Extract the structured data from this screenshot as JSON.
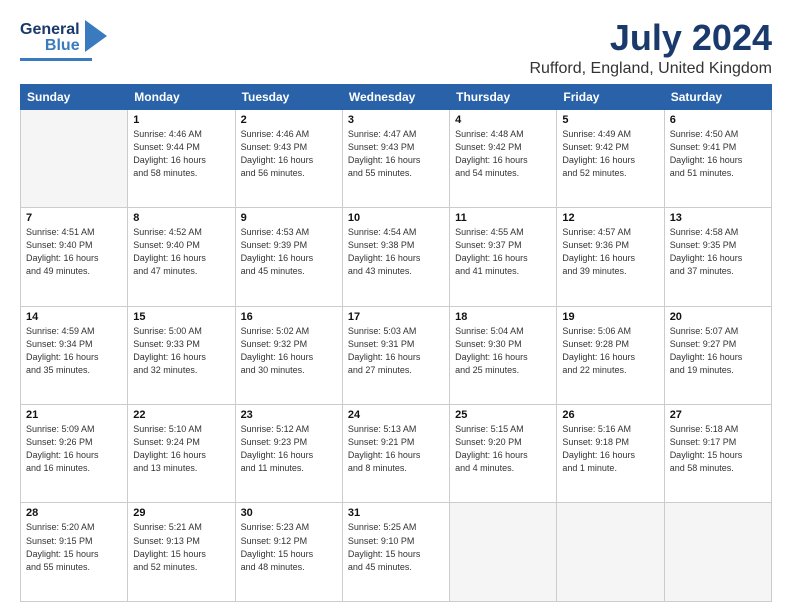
{
  "logo": {
    "line1": "General",
    "line2": "Blue"
  },
  "title": "July 2024",
  "subtitle": "Rufford, England, United Kingdom",
  "weekdays": [
    "Sunday",
    "Monday",
    "Tuesday",
    "Wednesday",
    "Thursday",
    "Friday",
    "Saturday"
  ],
  "weeks": [
    [
      {
        "day": "",
        "info": ""
      },
      {
        "day": "1",
        "info": "Sunrise: 4:46 AM\nSunset: 9:44 PM\nDaylight: 16 hours\nand 58 minutes."
      },
      {
        "day": "2",
        "info": "Sunrise: 4:46 AM\nSunset: 9:43 PM\nDaylight: 16 hours\nand 56 minutes."
      },
      {
        "day": "3",
        "info": "Sunrise: 4:47 AM\nSunset: 9:43 PM\nDaylight: 16 hours\nand 55 minutes."
      },
      {
        "day": "4",
        "info": "Sunrise: 4:48 AM\nSunset: 9:42 PM\nDaylight: 16 hours\nand 54 minutes."
      },
      {
        "day": "5",
        "info": "Sunrise: 4:49 AM\nSunset: 9:42 PM\nDaylight: 16 hours\nand 52 minutes."
      },
      {
        "day": "6",
        "info": "Sunrise: 4:50 AM\nSunset: 9:41 PM\nDaylight: 16 hours\nand 51 minutes."
      }
    ],
    [
      {
        "day": "7",
        "info": "Sunrise: 4:51 AM\nSunset: 9:40 PM\nDaylight: 16 hours\nand 49 minutes."
      },
      {
        "day": "8",
        "info": "Sunrise: 4:52 AM\nSunset: 9:40 PM\nDaylight: 16 hours\nand 47 minutes."
      },
      {
        "day": "9",
        "info": "Sunrise: 4:53 AM\nSunset: 9:39 PM\nDaylight: 16 hours\nand 45 minutes."
      },
      {
        "day": "10",
        "info": "Sunrise: 4:54 AM\nSunset: 9:38 PM\nDaylight: 16 hours\nand 43 minutes."
      },
      {
        "day": "11",
        "info": "Sunrise: 4:55 AM\nSunset: 9:37 PM\nDaylight: 16 hours\nand 41 minutes."
      },
      {
        "day": "12",
        "info": "Sunrise: 4:57 AM\nSunset: 9:36 PM\nDaylight: 16 hours\nand 39 minutes."
      },
      {
        "day": "13",
        "info": "Sunrise: 4:58 AM\nSunset: 9:35 PM\nDaylight: 16 hours\nand 37 minutes."
      }
    ],
    [
      {
        "day": "14",
        "info": "Sunrise: 4:59 AM\nSunset: 9:34 PM\nDaylight: 16 hours\nand 35 minutes."
      },
      {
        "day": "15",
        "info": "Sunrise: 5:00 AM\nSunset: 9:33 PM\nDaylight: 16 hours\nand 32 minutes."
      },
      {
        "day": "16",
        "info": "Sunrise: 5:02 AM\nSunset: 9:32 PM\nDaylight: 16 hours\nand 30 minutes."
      },
      {
        "day": "17",
        "info": "Sunrise: 5:03 AM\nSunset: 9:31 PM\nDaylight: 16 hours\nand 27 minutes."
      },
      {
        "day": "18",
        "info": "Sunrise: 5:04 AM\nSunset: 9:30 PM\nDaylight: 16 hours\nand 25 minutes."
      },
      {
        "day": "19",
        "info": "Sunrise: 5:06 AM\nSunset: 9:28 PM\nDaylight: 16 hours\nand 22 minutes."
      },
      {
        "day": "20",
        "info": "Sunrise: 5:07 AM\nSunset: 9:27 PM\nDaylight: 16 hours\nand 19 minutes."
      }
    ],
    [
      {
        "day": "21",
        "info": "Sunrise: 5:09 AM\nSunset: 9:26 PM\nDaylight: 16 hours\nand 16 minutes."
      },
      {
        "day": "22",
        "info": "Sunrise: 5:10 AM\nSunset: 9:24 PM\nDaylight: 16 hours\nand 13 minutes."
      },
      {
        "day": "23",
        "info": "Sunrise: 5:12 AM\nSunset: 9:23 PM\nDaylight: 16 hours\nand 11 minutes."
      },
      {
        "day": "24",
        "info": "Sunrise: 5:13 AM\nSunset: 9:21 PM\nDaylight: 16 hours\nand 8 minutes."
      },
      {
        "day": "25",
        "info": "Sunrise: 5:15 AM\nSunset: 9:20 PM\nDaylight: 16 hours\nand 4 minutes."
      },
      {
        "day": "26",
        "info": "Sunrise: 5:16 AM\nSunset: 9:18 PM\nDaylight: 16 hours\nand 1 minute."
      },
      {
        "day": "27",
        "info": "Sunrise: 5:18 AM\nSunset: 9:17 PM\nDaylight: 15 hours\nand 58 minutes."
      }
    ],
    [
      {
        "day": "28",
        "info": "Sunrise: 5:20 AM\nSunset: 9:15 PM\nDaylight: 15 hours\nand 55 minutes."
      },
      {
        "day": "29",
        "info": "Sunrise: 5:21 AM\nSunset: 9:13 PM\nDaylight: 15 hours\nand 52 minutes."
      },
      {
        "day": "30",
        "info": "Sunrise: 5:23 AM\nSunset: 9:12 PM\nDaylight: 15 hours\nand 48 minutes."
      },
      {
        "day": "31",
        "info": "Sunrise: 5:25 AM\nSunset: 9:10 PM\nDaylight: 15 hours\nand 45 minutes."
      },
      {
        "day": "",
        "info": ""
      },
      {
        "day": "",
        "info": ""
      },
      {
        "day": "",
        "info": ""
      }
    ]
  ]
}
